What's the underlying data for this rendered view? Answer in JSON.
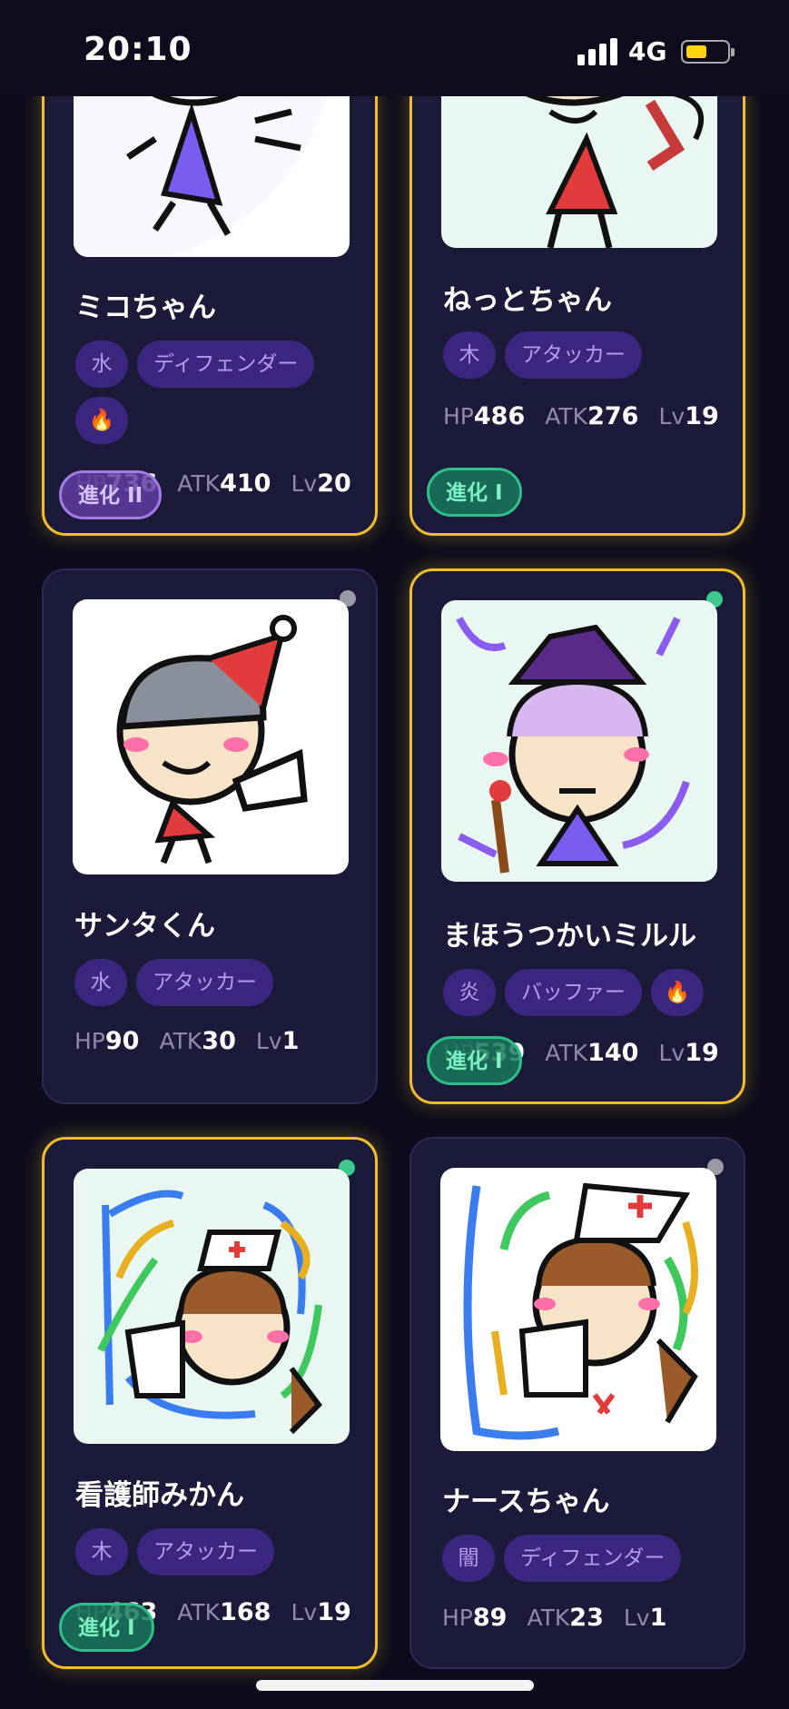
{
  "status": {
    "time": "20:10",
    "network": "4G",
    "battery_color": "#ffd21a"
  },
  "cards": [
    {
      "name": "ミコちゃん",
      "tags": [
        "水",
        "ディフェンダー",
        "🔥"
      ],
      "hp": "736",
      "atk": "410",
      "lv": "20",
      "evolution": "進化 II",
      "highlight": true
    },
    {
      "name": "ねっとちゃん",
      "tags": [
        "木",
        "アタッカー"
      ],
      "hp": "486",
      "atk": "276",
      "lv": "19",
      "evolution": "進化 I",
      "highlight": true
    },
    {
      "name": "サンタくん",
      "tags": [
        "水",
        "アタッカー"
      ],
      "hp": "90",
      "atk": "30",
      "lv": "1",
      "evolution": "",
      "highlight": false,
      "indicator": "grey"
    },
    {
      "name": "まほうつかいミルル",
      "tags": [
        "炎",
        "バッファー",
        "🔥"
      ],
      "hp": "539",
      "atk": "140",
      "lv": "19",
      "evolution": "進化 I",
      "highlight": true,
      "indicator": "green"
    },
    {
      "name": "看護師みかん",
      "tags": [
        "木",
        "アタッカー"
      ],
      "hp": "463",
      "atk": "168",
      "lv": "19",
      "evolution": "進化 I",
      "highlight": true,
      "indicator": "green"
    },
    {
      "name": "ナースちゃん",
      "tags": [
        "闇",
        "ディフェンダー"
      ],
      "hp": "89",
      "atk": "23",
      "lv": "1",
      "evolution": "",
      "highlight": false,
      "indicator": "grey"
    }
  ],
  "labels": {
    "hp": "HP",
    "atk": "ATK",
    "lv": "Lv"
  },
  "colors": {
    "accent_gold": "#f2bd2c",
    "tag_bg": "#3b2680",
    "evo_green": "#2fbf8a",
    "evo_purple": "#a57be6"
  }
}
